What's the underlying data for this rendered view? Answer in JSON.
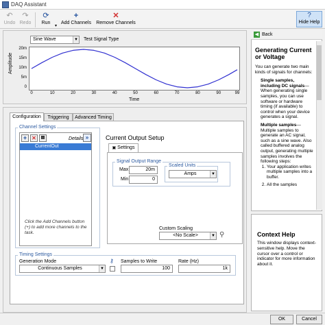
{
  "window": {
    "title": "DAQ Assistant"
  },
  "toolbar": {
    "undo": "Undo",
    "redo": "Redo",
    "run": "Run",
    "add_channels": "Add Channels",
    "remove_channels": "Remove Channels",
    "hide_help": "Hide Help"
  },
  "icons": [
    "undo-icon",
    "redo-icon",
    "run-icon",
    "add-icon",
    "remove-icon",
    "help-icon",
    "back-icon"
  ],
  "colors": {
    "selection": "#3a7bd5",
    "group_label": "#2c5aa0",
    "signal": "#2f2fd0",
    "remove": "#d23030"
  },
  "preview": {
    "signal_type_value": "Sine Wave",
    "signal_type_label": "Test Signal Type",
    "ylabel": "Amplitude",
    "xlabel": "Time"
  },
  "chart_data": {
    "type": "line",
    "xlabel": "Time",
    "ylabel": "Amplitude",
    "x_ticks": [
      "0",
      "10",
      "20",
      "30",
      "40",
      "50",
      "60",
      "70",
      "80",
      "90",
      "99"
    ],
    "y_ticks": [
      "20m",
      "15m",
      "10m",
      "5m",
      "0"
    ],
    "xlim": [
      0,
      99
    ],
    "ylim": [
      0,
      20
    ],
    "grid": false,
    "series": [
      {
        "x": [
          0,
          5,
          10,
          15,
          20,
          25,
          30,
          35,
          40,
          45,
          50,
          55,
          60,
          65,
          70,
          75,
          80,
          85,
          90,
          95,
          99
        ],
        "y": [
          10,
          13.1,
          15.9,
          18.1,
          19.5,
          20,
          19.5,
          18.1,
          15.9,
          13.1,
          10,
          6.9,
          4.1,
          1.9,
          0.5,
          0,
          0.5,
          1.9,
          4.1,
          6.9,
          9.4
        ]
      }
    ]
  },
  "tabs": [
    "Configuration",
    "Triggering",
    "Advanced Timing"
  ],
  "channel_settings": {
    "label": "Channel Settings",
    "details": "Details",
    "channel": "CurrentOut",
    "hint": "Click the Add Channels button (+) to add more channels to the task."
  },
  "setup": {
    "title": "Current Output Setup",
    "settings_tab": "Settings",
    "range_label": "Signal Output Range",
    "max_label": "Max",
    "max_value": "20m",
    "min_label": "Min",
    "min_value": "0",
    "units_label": "Scaled Units",
    "units_value": "Amps",
    "scaling_label": "Custom Scaling",
    "scaling_value": "<No Scale>"
  },
  "timing": {
    "label": "Timing Settings",
    "mode_label": "Generation Mode",
    "mode_value": "Continuous Samples",
    "samples_label": "Samples to Write",
    "samples_value": "100",
    "rate_label": "Rate (Hz)",
    "rate_value": "1k"
  },
  "help": {
    "back": "Back",
    "title": "Generating Current or Voltage",
    "intro": "You can generate two main kinds of signals for channels:",
    "b1_title": "Single samples, including DC signals",
    "b1_text": "—When generating single samples, you can use software or hardware timing (if available) to control when your device generates a signal.",
    "b2_title": "Multiple samples",
    "b2_text": "—Multiple samples to generate an AC signal, such as a sine wave. Also called buffered analog output, generating multiple samples involves the following steps:",
    "step1": "Your application writes multiple samples into a buffer.",
    "step2": "All the samples"
  },
  "context_help": {
    "title": "Context Help",
    "text": "This window displays context-sensitive help. Move the cursor over a control or indicator for more information about it."
  },
  "buttons": {
    "ok": "OK",
    "cancel": "Cancel"
  }
}
